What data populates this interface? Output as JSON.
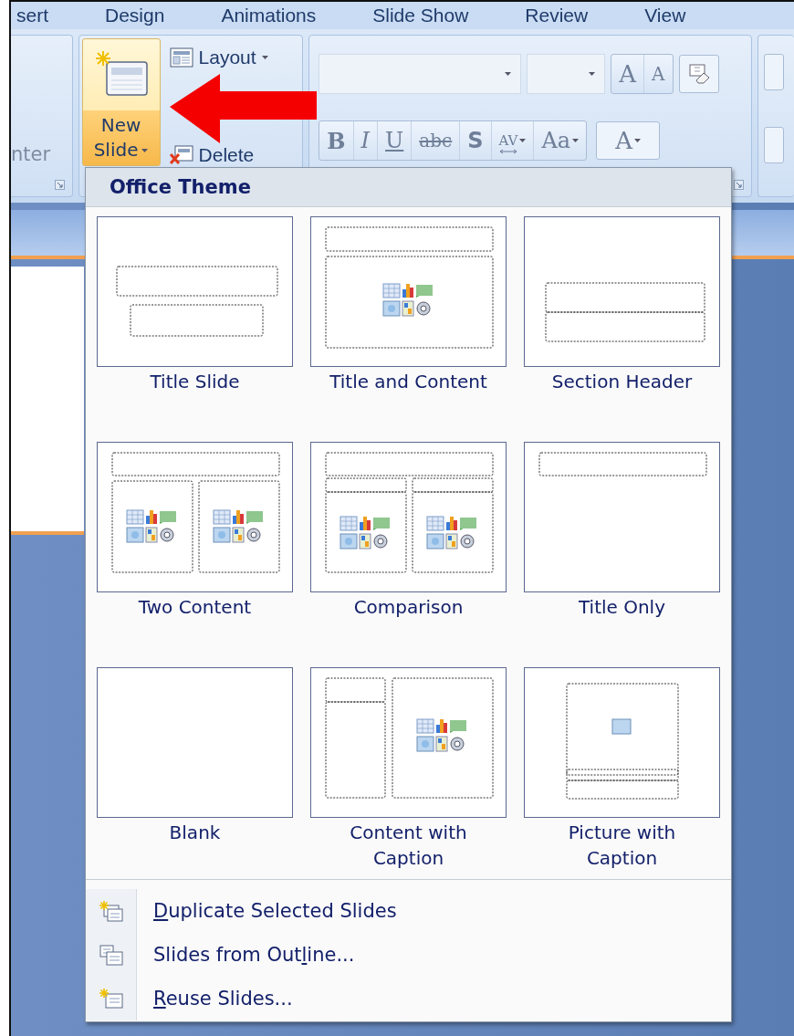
{
  "ribbon_tabs": [
    {
      "label": "sert"
    },
    {
      "label": "Design"
    },
    {
      "label": "Animations"
    },
    {
      "label": "Slide Show"
    },
    {
      "label": "Review"
    },
    {
      "label": "View"
    }
  ],
  "clipboard_group": {
    "button_label": "nter"
  },
  "slides_group": {
    "new_slide": {
      "label_lines": [
        "New",
        "Slide"
      ],
      "highlighted": true
    },
    "layout": {
      "label": "Layout"
    },
    "delete": {
      "label": "Delete"
    }
  },
  "font_group": {
    "size_buttons": [
      {
        "label": "A",
        "kind": "grow"
      },
      {
        "label": "A",
        "kind": "shrink"
      }
    ],
    "format_buttons": [
      {
        "label": "B",
        "kind": "bold"
      },
      {
        "label": "I",
        "kind": "italic"
      },
      {
        "label": "U",
        "kind": "underline"
      },
      {
        "label": "abc",
        "kind": "strike"
      },
      {
        "label": "S",
        "kind": "shadow"
      },
      {
        "label": "AV",
        "kind": "spacing"
      },
      {
        "label": "Aa",
        "kind": "case"
      }
    ],
    "color_button": {
      "label": "A"
    }
  },
  "menu": {
    "title": "Office Theme",
    "layouts": [
      {
        "kind": "title",
        "label": "Title Slide"
      },
      {
        "kind": "title_content",
        "label": "Title and Content"
      },
      {
        "kind": "section",
        "label": "Section Header"
      },
      {
        "kind": "two_content",
        "label": "Two Content"
      },
      {
        "kind": "comparison",
        "label": "Comparison"
      },
      {
        "kind": "title_only",
        "label": "Title Only"
      },
      {
        "kind": "blank",
        "label": "Blank"
      },
      {
        "kind": "content_caption",
        "label": "Content with Caption"
      },
      {
        "kind": "picture_caption",
        "label": "Picture with Caption"
      }
    ],
    "commands": [
      {
        "kind": "duplicate",
        "key": "D",
        "after": "uplicate Selected Slides"
      },
      {
        "kind": "outline",
        "before": "Slides from Out",
        "key": "l",
        "after": "ine..."
      },
      {
        "kind": "reuse",
        "key": "R",
        "after": "euse Slides..."
      }
    ]
  }
}
